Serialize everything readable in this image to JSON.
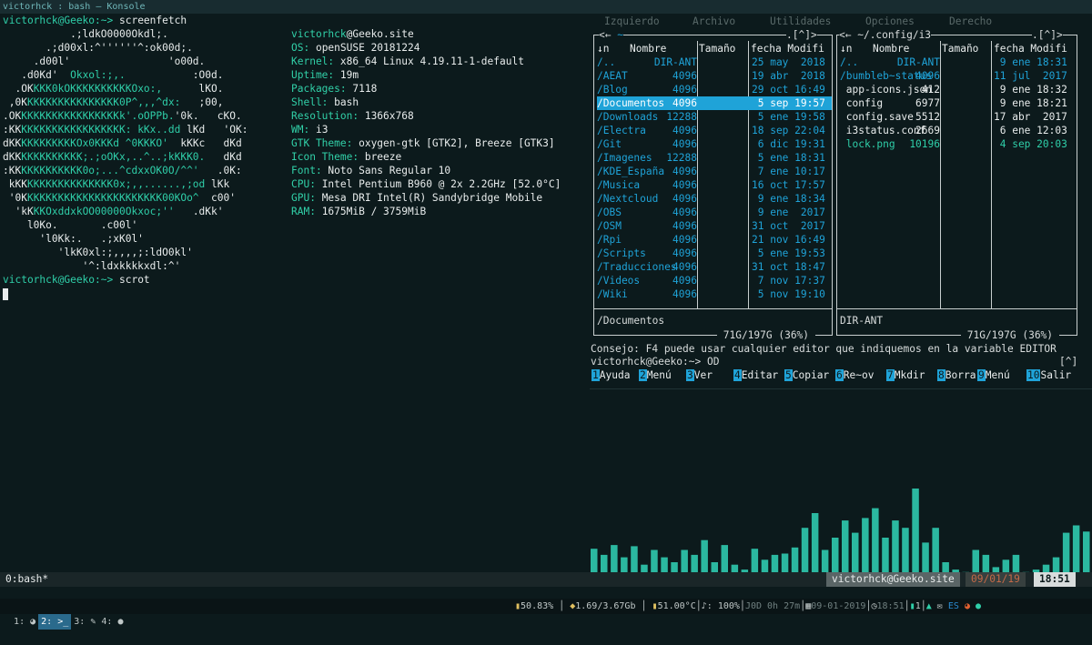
{
  "window": {
    "title": "victorhck : bash — Konsole"
  },
  "terminal": {
    "prompt1": "victorhck@Geeko:~> ",
    "cmd1": "screenfetch",
    "art": [
      {
        "w": "           .;ldkO0000Okdl;.",
        "g": ""
      },
      {
        "w": "       .;d00xl:^''''''^:ok00d;.",
        "g": ""
      },
      {
        "w": "     .d00l'                'o00d.",
        "g": ""
      },
      {
        "w": "   .d0Kd'  ",
        "g": "Okxol:;,."
      },
      {
        "w": "  .OK",
        "g": "KKK0kOKKKKKKKKKKOxo:,"
      },
      {
        "w": " ,0K",
        "g": "KKKKKKKKKKKKKKK0P^,,,^dx:"
      },
      {
        "w": ".OK",
        "g": "KKKKKKKKKKKKKKKKk'.oOPPb."
      },
      {
        "w": ":KK",
        "g": "KKKKKKKKKKKKKKKKK: kKx..dd"
      },
      {
        "w": "dKK",
        "g": "KKKKKKKKKOx0KKKd ^0KKKO'"
      },
      {
        "w": "dKK",
        "g": "KKKKKKKKKK;.;oOKx,..^..;kKKK0."
      },
      {
        "w": ":KK",
        "g": "KKKKKKKKKK0o;...^cdxxOK0O/^^'"
      },
      {
        "w": " kKK",
        "g": "KKKKKKKKKKKKKK0x;,,......,;od"
      },
      {
        "w": " '0K",
        "g": "KKKKKKKKKKKKKKKKKKKKKK00KOo^"
      },
      {
        "w": "  'kK",
        "g": "KKOxddxkOO00000Okxoc;''"
      },
      {
        "w": "    l0Ko.",
        "g": ""
      },
      {
        "w": "      'l0Kk:.",
        "g": ""
      },
      {
        "w": "         'lkK0xl:;,,,,;:ldO0kl'",
        "g": ""
      },
      {
        "w": "             '^:ldxkkkkxdl:^'",
        "g": ""
      }
    ],
    "art_right": [
      "",
      "",
      "",
      "           :O0d.",
      "      lKO.",
      "   ;00,",
      "'0k.   cKO.",
      " lKd   'OK:",
      "  kKKc   dKd",
      "   dKd",
      "   .0K:",
      " lKk",
      "  c00'",
      "   .dKk'",
      "       .c00l'",
      "   .;xK0l'",
      "",
      ""
    ],
    "user": "victorhck",
    "host": "@Geeko.site",
    "info": [
      {
        "k": "OS:",
        "v": " openSUSE 20181224"
      },
      {
        "k": "Kernel:",
        "v": " x86_64 Linux 4.19.11-1-default"
      },
      {
        "k": "Uptime:",
        "v": " 19m"
      },
      {
        "k": "Packages:",
        "v": " 7118"
      },
      {
        "k": "Shell:",
        "v": " bash"
      },
      {
        "k": "Resolution:",
        "v": " 1366x768"
      },
      {
        "k": "WM:",
        "v": " i3"
      },
      {
        "k": "GTK Theme:",
        "v": " oxygen-gtk [GTK2], Breeze [GTK3]"
      },
      {
        "k": "Icon Theme:",
        "v": " breeze"
      },
      {
        "k": "Font:",
        "v": " Noto Sans Regular 10"
      },
      {
        "k": "CPU:",
        "v": " Intel Pentium B960 @ 2x 2.2GHz [52.0°C]"
      },
      {
        "k": "GPU:",
        "v": " Mesa DRI Intel(R) Sandybridge Mobile"
      },
      {
        "k": "RAM:",
        "v": " 1675MiB / 3759MiB"
      }
    ],
    "prompt2": "victorhck@Geeko:~> ",
    "cmd2": "scrot"
  },
  "mc": {
    "menu": [
      "Izquierdo",
      "Archivo",
      "Utilidades",
      "Opciones",
      "Derecho"
    ],
    "left_path": "~",
    "left_corner": ".[^]>",
    "right_path": "~/.config/i3",
    "right_corner": ".[^]>",
    "cols": {
      "n": "↓n",
      "name": "Nombre",
      "size": "Tamaño",
      "date": "fecha Modifi"
    },
    "left_rows": [
      [
        "/..",
        "DIR-ANT",
        "25 may  2018"
      ],
      [
        "/AEAT",
        "4096",
        "19 abr  2018"
      ],
      [
        "/Blog",
        "4096",
        "29 oct 16:49"
      ],
      [
        "/Documentos",
        "4096",
        " 5 sep 19:57"
      ],
      [
        "/Downloads",
        "12288",
        " 5 ene 19:58"
      ],
      [
        "/Electra",
        "4096",
        "18 sep 22:04"
      ],
      [
        "/Git",
        "4096",
        " 6 dic 19:31"
      ],
      [
        "/Imagenes",
        "12288",
        " 5 ene 18:31"
      ],
      [
        "/KDE_España",
        "4096",
        " 7 ene 10:17"
      ],
      [
        "/Musica",
        "4096",
        "16 oct 17:57"
      ],
      [
        "/Nextcloud",
        "4096",
        " 9 ene 18:34"
      ],
      [
        "/OBS",
        "4096",
        " 9 ene  2017"
      ],
      [
        "/OSM",
        "4096",
        "31 oct  2017"
      ],
      [
        "/Rpi",
        "4096",
        "21 nov 16:49"
      ],
      [
        "/Scripts",
        "4096",
        " 5 ene 19:53"
      ],
      [
        "/Traducciones",
        "4096",
        "31 oct 18:47"
      ],
      [
        "/Videos",
        "4096",
        " 7 nov 17:37"
      ],
      [
        "/Wiki",
        "4096",
        " 5 nov 19:10"
      ]
    ],
    "right_rows": [
      [
        "/..",
        "DIR-ANT",
        " 9 ene 18:31",
        "c"
      ],
      [
        "/bumbleb~status",
        "4096",
        "11 jul  2017",
        "c"
      ],
      [
        " app-icons.json",
        "412",
        " 9 ene 18:32",
        "w"
      ],
      [
        " config",
        "6977",
        " 9 ene 18:21",
        "w"
      ],
      [
        " config.save",
        "5512",
        "17 abr  2017",
        "w"
      ],
      [
        " i3status.conf",
        "2669",
        " 6 ene 12:03",
        "w"
      ],
      [
        " lock.png",
        "10196",
        " 4 sep 20:03",
        "g"
      ]
    ],
    "left_status": "/Documentos",
    "right_status": "DIR-ANT",
    "left_disk": " 71G/197G (36%) ",
    "right_disk": " 71G/197G (36%) ",
    "hint": "Consejo: F4 puede usar cualquier editor que indiquemos en la variable EDITOR",
    "hint_corner": "[^]",
    "prompt": "victorhck@Geeko:~> OD",
    "fkeys": [
      [
        "1",
        "Ayuda"
      ],
      [
        "2",
        "Menú"
      ],
      [
        "3",
        "Ver"
      ],
      [
        "4",
        "Editar"
      ],
      [
        "5",
        "Copiar"
      ],
      [
        "6",
        "Re~ov"
      ],
      [
        "7",
        "Mkdir"
      ],
      [
        "8",
        "Borrar"
      ],
      [
        "9",
        "Menú"
      ],
      [
        "10",
        "Salir"
      ]
    ]
  },
  "visualizer": {
    "levels": [
      0.31,
      0.26,
      0.34,
      0.24,
      0.33,
      0.18,
      0.3,
      0.24,
      0.2,
      0.3,
      0.26,
      0.38,
      0.2,
      0.34,
      0.18,
      0.14,
      0.31,
      0.22,
      0.26,
      0.27,
      0.32,
      0.48,
      0.6,
      0.3,
      0.4,
      0.54,
      0.44,
      0.56,
      0.64,
      0.4,
      0.54,
      0.48,
      0.8,
      0.36,
      0.48,
      0.2,
      0.14,
      0.12,
      0.3,
      0.26,
      0.16,
      0.22,
      0.26,
      0.12,
      0.14,
      0.18,
      0.24,
      0.44,
      0.5,
      0.45
    ],
    "color": "#2bb8a0"
  },
  "tmux": {
    "window": "0:bash*",
    "host": "victorhck@Geeko.site",
    "date": "09/01/19",
    "time": "18:51"
  },
  "taskbar": {
    "workspaces": [
      "1:",
      "2:",
      "3:",
      "4:"
    ],
    "battery": "50.83%",
    "mem": "1.69/3.67Gb",
    "temp": "51.00°C",
    "vol": "♪: 100%",
    "net": "J0D 0h 27m",
    "date": "09-01-2019",
    "clock": "18:51",
    "count": "1",
    "lang": "ES"
  }
}
